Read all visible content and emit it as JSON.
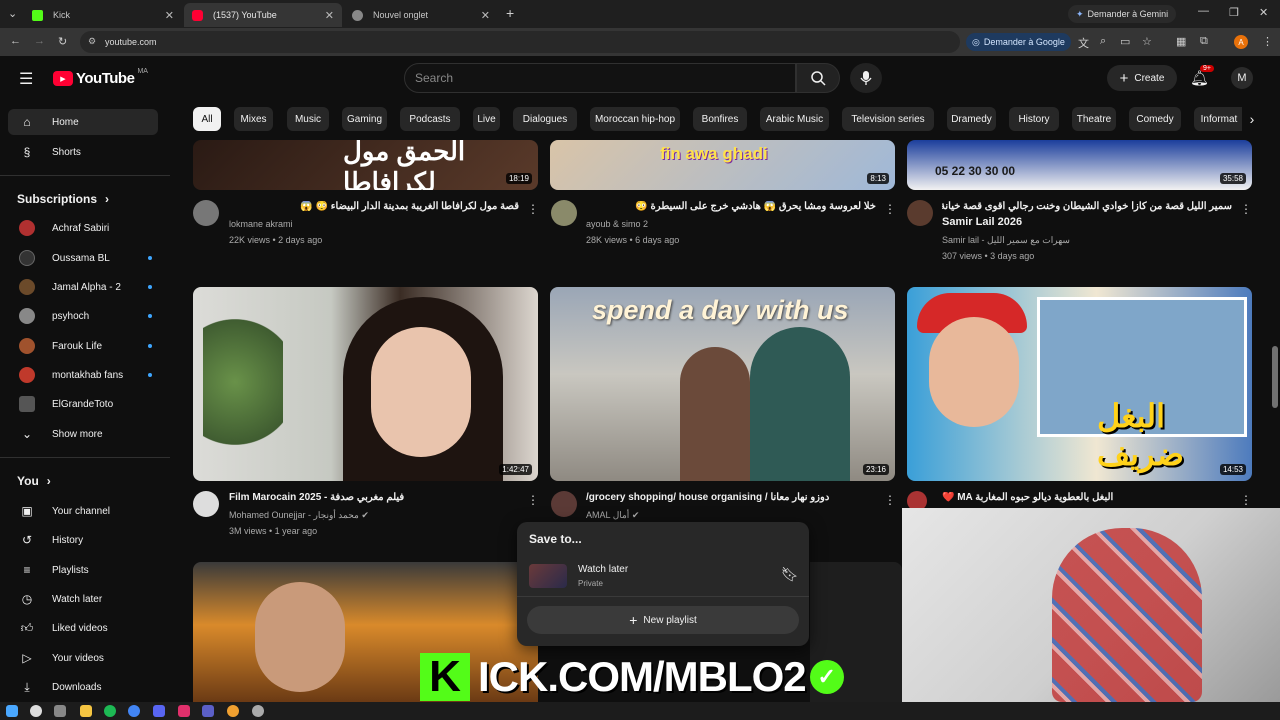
{
  "browser": {
    "tabs": [
      {
        "title": "Kick",
        "favicon_color": "#53fc18"
      },
      {
        "title": "(1537) YouTube",
        "favicon_color": "#ff0033"
      },
      {
        "title": "Nouvel onglet",
        "favicon_color": "#cccccc"
      }
    ],
    "gemini_label": "Demander à Gemini",
    "url": "youtube.com",
    "google_button": "Demander à Google"
  },
  "header": {
    "logo_text": "YouTube",
    "country_code": "MA",
    "search_placeholder": "Search",
    "create_label": "Create",
    "notif_badge": "9+"
  },
  "chips": [
    "All",
    "Mixes",
    "Music",
    "Gaming",
    "Podcasts",
    "Live",
    "Dialogues",
    "Moroccan hip-hop",
    "Bonfires",
    "Arabic Music",
    "Television series",
    "Dramedy",
    "History",
    "Theatre",
    "Comedy",
    "Informat"
  ],
  "sidebar": {
    "top": [
      {
        "label": "Home",
        "icon": "home-icon"
      },
      {
        "label": "Shorts",
        "icon": "shorts-icon"
      }
    ],
    "subscriptions_heading": "Subscriptions",
    "subscriptions": [
      {
        "label": "Achraf Sabiri",
        "color": "#b03030",
        "dot": false
      },
      {
        "label": "Oussama BL",
        "color": "#333333",
        "dot": true
      },
      {
        "label": "Jamal Alpha - 2",
        "color": "#6b4a2a",
        "dot": true
      },
      {
        "label": "psyhoch",
        "color": "#888888",
        "dot": true
      },
      {
        "label": "Farouk Life",
        "color": "#a0522d",
        "dot": true
      },
      {
        "label": "montakhab fans",
        "color": "#c0392b",
        "dot": true
      },
      {
        "label": "ElGrandeToto",
        "color": "#555555",
        "dot": false
      }
    ],
    "show_more": "Show more",
    "you_heading": "You",
    "you_items": [
      {
        "label": "Your channel",
        "icon": "channel-icon"
      },
      {
        "label": "History",
        "icon": "history-icon"
      },
      {
        "label": "Playlists",
        "icon": "playlists-icon"
      },
      {
        "label": "Watch later",
        "icon": "watch-later-icon"
      },
      {
        "label": "Liked videos",
        "icon": "like-icon"
      },
      {
        "label": "Your videos",
        "icon": "your-videos-icon"
      },
      {
        "label": "Downloads",
        "icon": "download-icon"
      }
    ]
  },
  "videos_row1": [
    {
      "duration": "18:19",
      "title": "قصة مول لكرافاطا الغريبة بمدينة الدار البيضاء 😳 😱",
      "channel": "lokmane akrami",
      "meta": "22K views • 2 days ago",
      "thumb_text": "الحمق مول لكرافاطا"
    },
    {
      "duration": "8:13",
      "title": "خلا لعروسة ومشا يحرق 😱 هادشي خرج على السيطرة 😳",
      "channel": "ayoub & simo 2",
      "meta": "28K views • 6 days ago",
      "thumb_text": "fin awa ghadi"
    },
    {
      "duration": "35:58",
      "title": "سمير الليل قصة من كازا خوادي الشيطان وخنت رجالي أقوى قصة خيانة",
      "title2": "Samir Lail 2026",
      "channel": "Samir lail - سهرات مع سمير الليل",
      "meta": "307 views • 3 days ago",
      "thumb_text": "05 22 30 30 00"
    }
  ],
  "videos_row2": [
    {
      "duration": "1:42:47",
      "title": "Film Marocain 2025 - فيلم مغربي صدفة",
      "channel": "Mohamed Ounejjar - محمد أونجار",
      "meta": "3M views • 1 year ago"
    },
    {
      "duration": "23:16",
      "title": "/grocery shopping/ house organising / دوزو نهار معانا",
      "channel": "AMAL أمال",
      "meta": "",
      "thumb_text": "spend a day with us"
    },
    {
      "duration": "14:53",
      "title": "❤️ MA البغل بالعطوية ديالو حبوه المغاربة",
      "channel": "",
      "meta": "",
      "thumb_text": "البغل ضريف"
    }
  ],
  "save_popup": {
    "title": "Save to...",
    "item_label": "Watch later",
    "item_privacy": "Private",
    "new_playlist": "New playlist"
  },
  "overlay": {
    "kick_text": "ICK.COM/MBLO2",
    "kick_letter": "K"
  }
}
